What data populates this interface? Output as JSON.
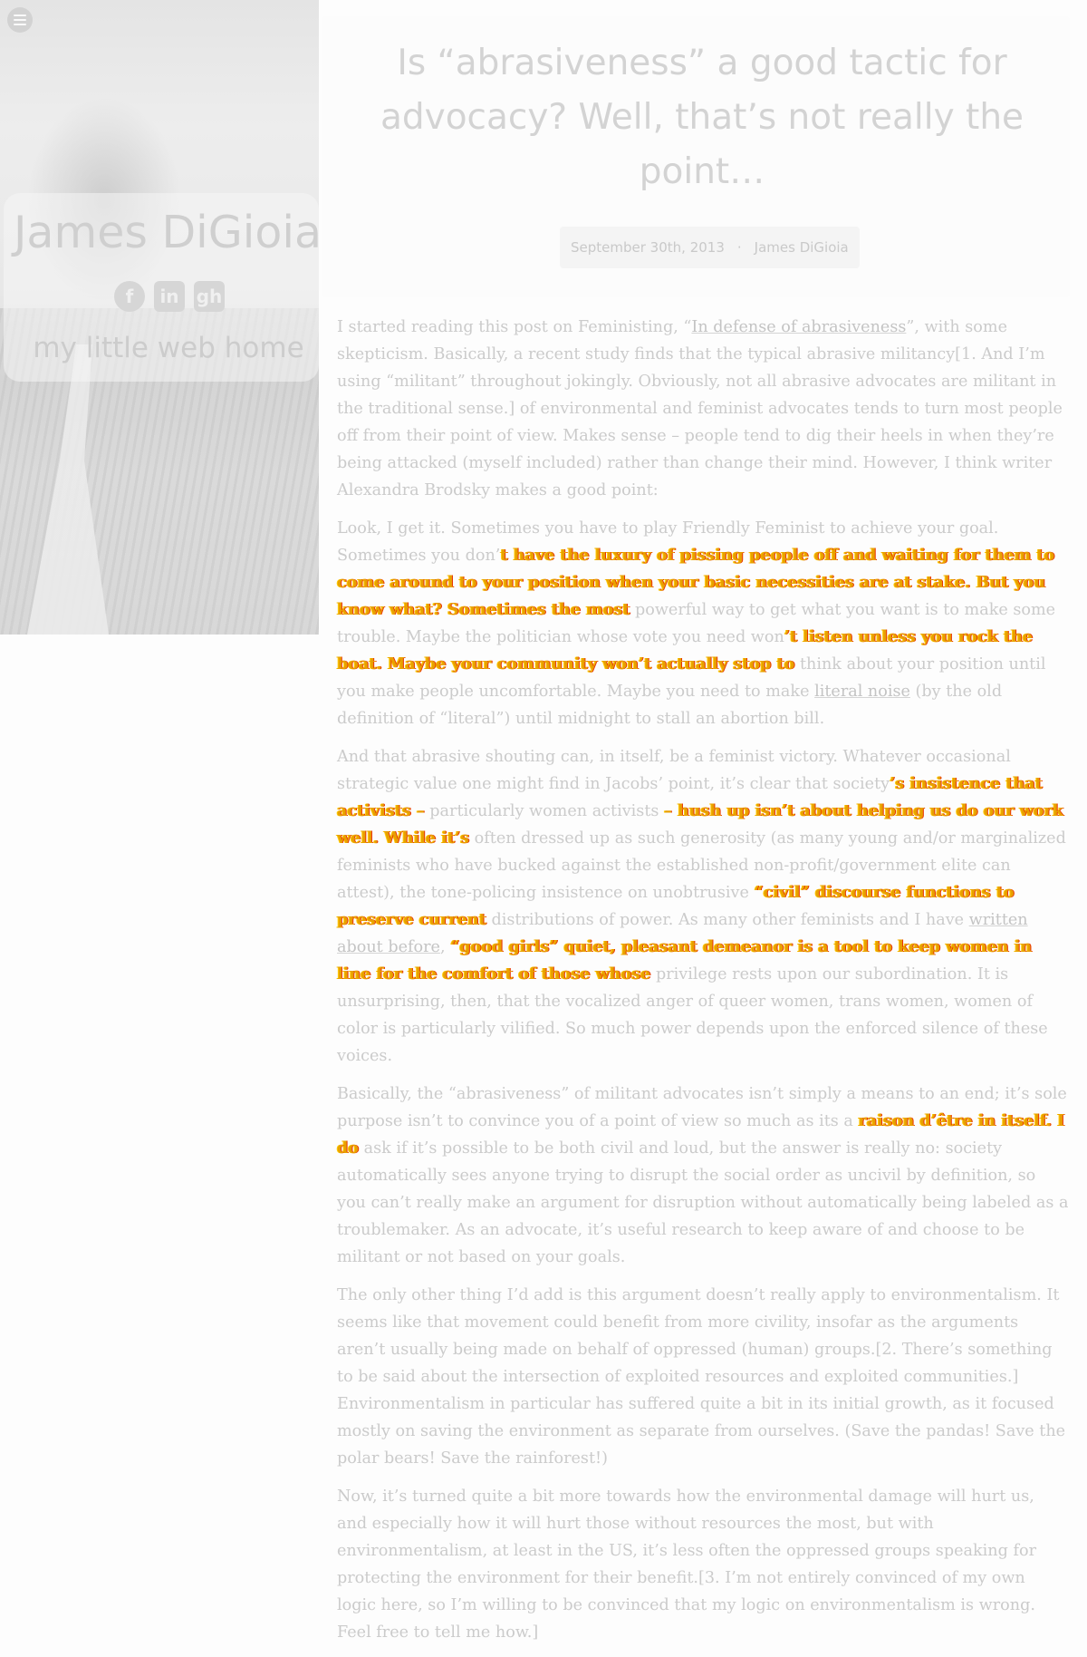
{
  "sidebar": {
    "site_title": "James DiGioia",
    "tagline": "my little web home",
    "social": [
      {
        "icon": "facebook-icon",
        "glyph": "f"
      },
      {
        "icon": "linkedin-icon",
        "glyph": "in"
      },
      {
        "icon": "github-icon",
        "glyph": "gh"
      }
    ]
  },
  "post": {
    "title": "Is “abrasiveness” a good tactic for advocacy? Well, that’s not really the point…",
    "date": "September 30th, 2013",
    "separator": "·",
    "author": "James DiGioia",
    "p1_a": "I started reading this post on Feministing, “",
    "p1_link": "In defense of abrasiveness",
    "p1_b": "”, with some skepticism. Basically, a recent study finds that the typical abrasive militancy[1. And I’m using “militant” throughout jokingly. Obviously, not all abrasive advocates are militant in the traditional sense.] of environmental and feminist advocates tends to turn most people off from their point of view. Makes sense – people tend to dig their heels in when they’re being attacked (myself included) rather than change their mind. However, I think writer Alexandra Brodsky makes a good point:",
    "p2_a": "Look, I get it. Sometimes you have to play Friendly Feminist to achieve your goal. Sometimes you don’",
    "p2_hl1": "t have the luxury of pissing people off and waiting for them to come around to your position when your basic necessities are at stake. But you know what? Sometimes the most",
    "p2_b": "powerful way to get what you want is to make some trouble. Maybe the politician whose vote you need won",
    "p2_hl2": "’t listen unless you rock the boat. Maybe your community won’t actually stop to",
    "p2_c": "think about your position until you make people uncomfortable. Maybe you need to make ",
    "p2_link": "literal noise",
    "p2_d": " (by the old definition of “literal”) until midnight to stall an abortion bill.",
    "p3_a": "And that abrasive shouting can, in itself, be a feminist victory. Whatever occasional strategic value one might find in Jacobs’ point, it’s clear that society",
    "p3_hl1": "’s insistence that activists –",
    "p3_b": "particularly women activists ",
    "p3_hl2": "– hush up isn’t about helping us do our work well. While it’s",
    "p3_c": "often dressed up as such generosity (as many young and/or marginalized feminists who have bucked against the established non-profit/government elite can attest), the tone-policing insistence on unobtrusive ",
    "p3_hl3": "“civil” discourse functions to preserve current",
    "p3_d": "distributions of power. As many other feminists and I have ",
    "p3_link": "written about before",
    "p3_e": ", ",
    "p3_hl4": "“good girls” quiet, pleasant demeanor is a tool to keep women in line for the comfort of those whose",
    "p3_f": "privilege rests upon our subordination. It is unsurprising, then, that the vocalized anger of queer women, trans women, women of color is particularly vilified. So much power depends upon the enforced silence of these voices.",
    "p4_a": "Basically, the “abrasiveness” of militant advocates isn’t simply a means to an end; it’s sole purpose isn’t to convince you of a point of view so much as its a ",
    "p4_hl": "raison d’être in itself. I do",
    "p4_b": "ask if it’s possible to be both civil and loud, but the answer is really no: society automatically sees anyone trying to disrupt the social order as uncivil by definition, so you can’t really make an argument for disruption without automatically being labeled as a troublemaker. As an advocate, it’s useful research to keep aware of and choose to be militant or not based on your goals.",
    "p5": "The only other thing I’d add is this argument doesn’t really apply to environmentalism. It seems like that movement could benefit from more civility, insofar as the arguments aren’t usually being made on behalf of oppressed (human) groups.[2. There’s something to be said about the intersection of exploited resources and exploited communities.] Environmentalism in particular has suffered quite a bit in its initial growth, as it focused mostly on saving the environment as separate from ourselves. (Save the pandas! Save the polar bears! Save the rainforest!)",
    "p6": "Now, it’s turned quite a bit more towards how the environmental damage will hurt us, and especially how it will hurt those without resources the most, but with environmentalism, at least in the US, it’s less often the oppressed groups speaking for protecting the environment for their benefit.[3. I’m not entirely convinced of my own logic here, so I’m willing to be convinced that my logic on environmentalism is wrong. Feel free to tell me how.]"
  }
}
